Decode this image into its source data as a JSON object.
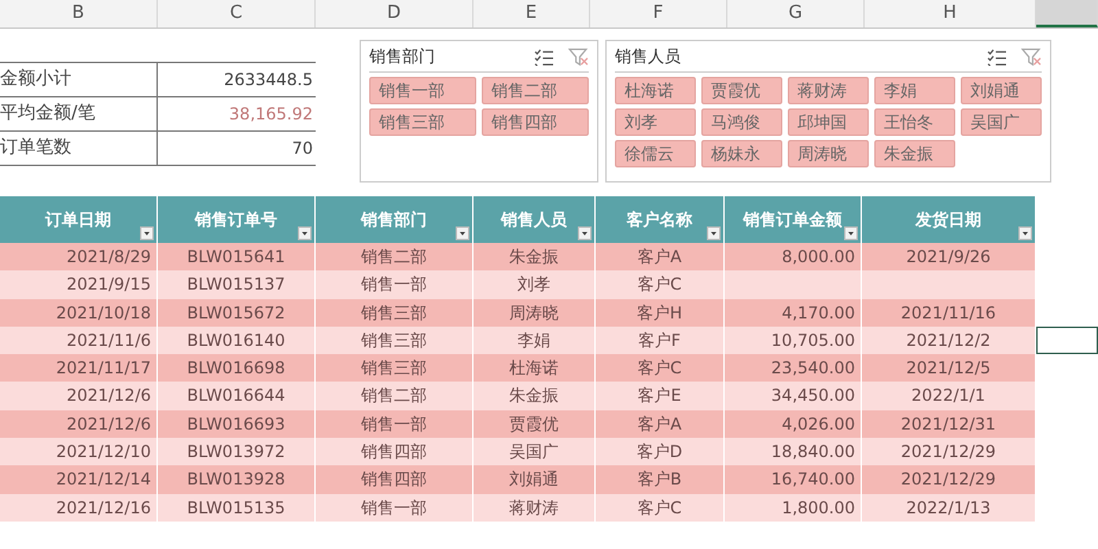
{
  "column_headers": [
    "B",
    "C",
    "D",
    "E",
    "F",
    "G",
    "H"
  ],
  "summary": [
    {
      "label": "金额小计",
      "value": "2633448.5",
      "kind": "plain"
    },
    {
      "label": "平均金额/笔",
      "value": "38,165.92",
      "kind": "accent"
    },
    {
      "label": "订单笔数",
      "value": "70",
      "kind": "plain"
    }
  ],
  "slicers": [
    {
      "title": "销售部门",
      "items": [
        {
          "label": "销售一部",
          "selected": true
        },
        {
          "label": "销售二部",
          "selected": true
        },
        {
          "label": "销售三部",
          "selected": true
        },
        {
          "label": "销售四部",
          "selected": true
        }
      ]
    },
    {
      "title": "销售人员",
      "items": [
        {
          "label": "杜海诺",
          "selected": true
        },
        {
          "label": "贾霞优",
          "selected": true
        },
        {
          "label": "蒋财涛",
          "selected": true
        },
        {
          "label": "李娟",
          "selected": true
        },
        {
          "label": "刘娟通",
          "selected": true
        },
        {
          "label": "刘孝",
          "selected": true
        },
        {
          "label": "马鸿俊",
          "selected": true
        },
        {
          "label": "邱坤国",
          "selected": true
        },
        {
          "label": "王怡冬",
          "selected": true
        },
        {
          "label": "吴国广",
          "selected": true
        },
        {
          "label": "徐儒云",
          "selected": true
        },
        {
          "label": "杨妹永",
          "selected": true
        },
        {
          "label": "周涛晓",
          "selected": true
        },
        {
          "label": "朱金振",
          "selected": true
        }
      ]
    }
  ],
  "table": {
    "columns": [
      "订单日期",
      "销售订单号",
      "销售部门",
      "销售人员",
      "客户名称",
      "销售订单金额",
      "发货日期"
    ],
    "rows": [
      {
        "cells": [
          "2021/8/29",
          "BLW015641",
          "销售二部",
          "朱金振",
          "客户A",
          "8,000.00",
          "2021/9/26"
        ],
        "active": false
      },
      {
        "cells": [
          "2021/9/15",
          "BLW015137",
          "销售一部",
          "刘孝",
          "客户C",
          null,
          null
        ],
        "active": false
      },
      {
        "cells": [
          "2021/10/18",
          "BLW015672",
          "销售三部",
          "周涛晓",
          "客户H",
          "4,170.00",
          "2021/11/16"
        ],
        "active": false
      },
      {
        "cells": [
          "2021/11/6",
          "BLW016140",
          "销售三部",
          "李娟",
          "客户F",
          "10,705.00",
          "2021/12/2"
        ],
        "active": true
      },
      {
        "cells": [
          "2021/11/17",
          "BLW016698",
          "销售三部",
          "杜海诺",
          "客户C",
          "23,540.00",
          "2021/12/5"
        ],
        "active": false
      },
      {
        "cells": [
          "2021/12/6",
          "BLW016644",
          "销售二部",
          "朱金振",
          "客户E",
          "34,450.00",
          "2022/1/1"
        ],
        "active": false
      },
      {
        "cells": [
          "2021/12/6",
          "BLW016693",
          "销售一部",
          "贾霞优",
          "客户A",
          "4,026.00",
          "2021/12/31"
        ],
        "active": false
      },
      {
        "cells": [
          "2021/12/10",
          "BLW013972",
          "销售四部",
          "吴国广",
          "客户D",
          "18,840.00",
          "2021/12/29"
        ],
        "active": false
      },
      {
        "cells": [
          "2021/12/14",
          "BLW013928",
          "销售四部",
          "刘娟通",
          "客户B",
          "16,740.00",
          "2021/12/29"
        ],
        "active": false
      },
      {
        "cells": [
          "2021/12/16",
          "BLW015135",
          "销售一部",
          "蒋财涛",
          "客户C",
          "1,800.00",
          "2022/1/13"
        ],
        "active": false
      }
    ]
  }
}
